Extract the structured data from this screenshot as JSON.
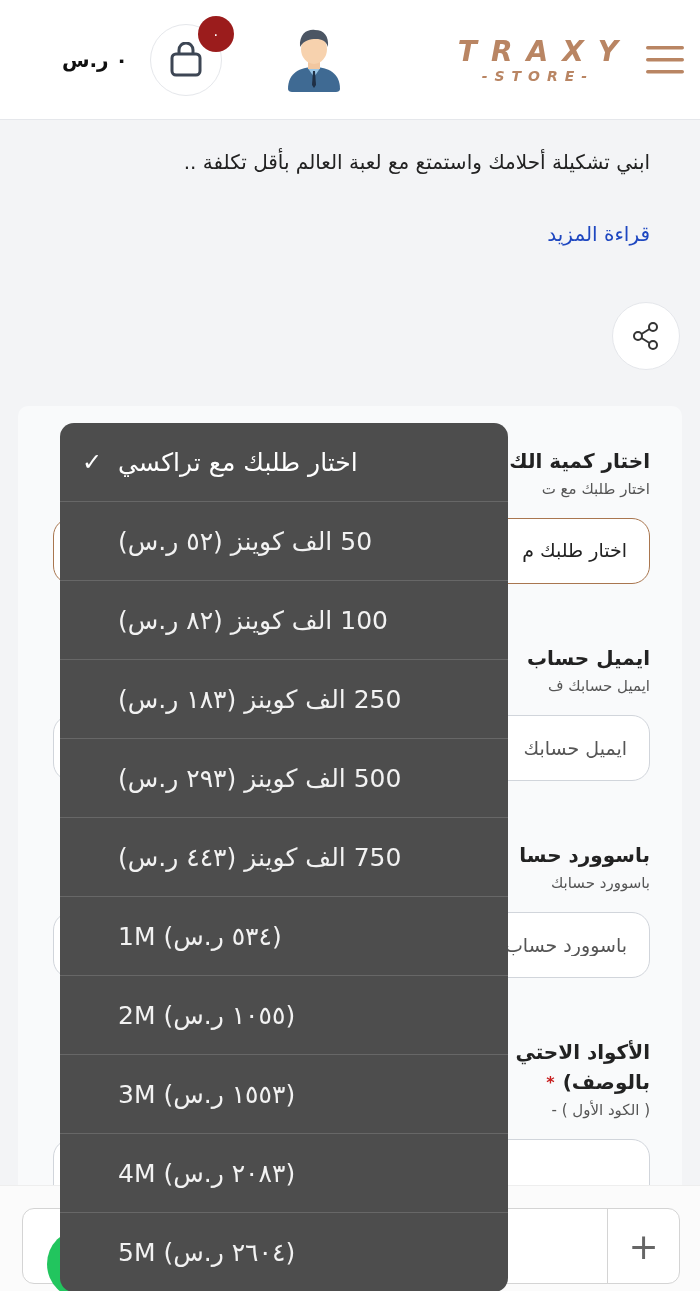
{
  "header": {
    "logo_title": "TRAXY",
    "logo_subtitle": "-STORE-",
    "cart_count": "٠",
    "cart_total": "٠ ر.س"
  },
  "description": {
    "text": "ابني تشكيلة أحلامك واستمتع مع لعبة العالم بأقل تكلفة ..",
    "read_more": "قراءة المزيد"
  },
  "form": {
    "fields": [
      {
        "kind": "select",
        "label": "اختار كمية الك",
        "hint": "اختار طلبك مع ت",
        "value": "اختار طلبك م"
      },
      {
        "kind": "input",
        "label": "ايميل حساب",
        "hint": "ايميل حسابك ف",
        "placeholder": "ايميل حسابك"
      },
      {
        "kind": "input",
        "label": "باسوورد حسا",
        "hint": "باسوورد حسابك",
        "placeholder": "باسوورد حساب"
      },
      {
        "kind": "input",
        "label": "الأكواد الاحتي",
        "label_line2": "بالوصف)",
        "required_mark": "*",
        "hint": "( الكود الأول ) -"
      }
    ]
  },
  "dropdown": {
    "options": [
      {
        "label": "اختار طلبك مع تراكسي",
        "check": "✓",
        "selected": true
      },
      {
        "label": "50 الف كوينز (٥٢ ر.س)",
        "selected": false
      },
      {
        "label": "100 الف كوينز (٨٢ ر.س)",
        "selected": false
      },
      {
        "label": "250 الف كوينز (١٨٣ ر.س)",
        "selected": false
      },
      {
        "label": "500 الف كوينز (٢٩٣ ر.س)",
        "selected": false
      },
      {
        "label": "750 الف كوينز (٤٤٣ ر.س)",
        "selected": false
      },
      {
        "label": "1M (٥٣٤ ر.س)",
        "selected": false
      },
      {
        "label": "2M (١٠٥٥ ر.س)",
        "selected": false
      },
      {
        "label": "3M (١٥٥٣ ر.س)",
        "selected": false
      },
      {
        "label": "4M (٢٠٨٣ ر.س)",
        "selected": false
      },
      {
        "label": "5M (٢٦٠٤ ر.س)",
        "selected": false
      }
    ]
  },
  "quantity": {
    "plus": "+"
  }
}
